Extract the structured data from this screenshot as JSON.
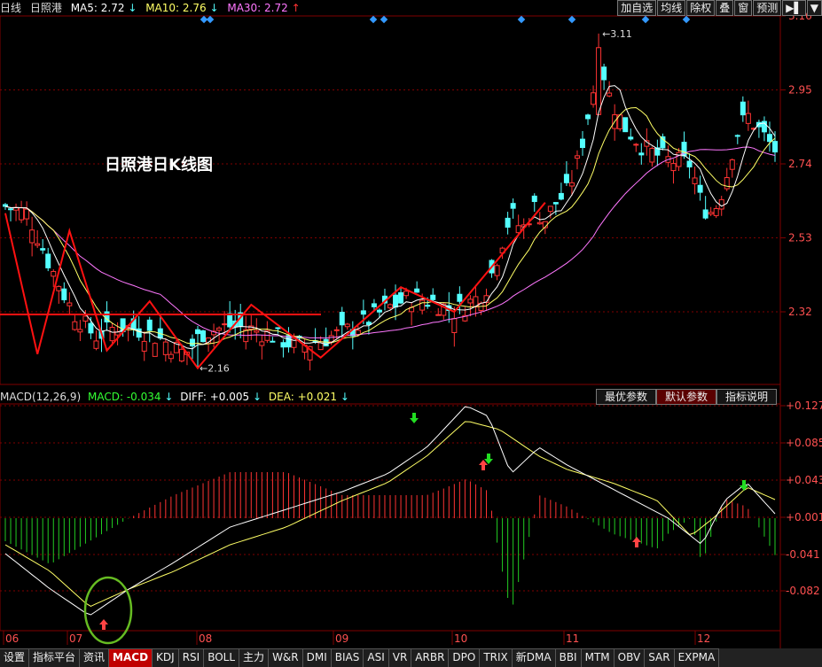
{
  "header": {
    "period": "日线",
    "stock_name": "日照港",
    "ma5_label": "MA5:",
    "ma5_value": "2.72",
    "ma5_arrow": "↓",
    "ma10_label": "MA10:",
    "ma10_value": "2.76",
    "ma10_arrow": "↓",
    "ma30_label": "MA30:",
    "ma30_value": "2.72",
    "ma30_arrow": "↑"
  },
  "toolbar": {
    "add_watch": "加自选",
    "ma_line": "均线",
    "ex_right": "除权",
    "overlay": "叠",
    "window": "窗",
    "forecast": "预测",
    "more": "▶▌",
    "menu": "▼"
  },
  "chart_title": "日照港日K线图",
  "price_axis": [
    "3.16",
    "2.95",
    "2.74",
    "2.53",
    "2.32"
  ],
  "annotations": {
    "high": "3.11",
    "low": "2.16"
  },
  "macd_header": {
    "name": "MACD(12,26,9)",
    "macd_label": "MACD:",
    "macd_value": "-0.034",
    "macd_arrow": "↓",
    "diff_label": "DIFF:",
    "diff_value": "+0.005",
    "diff_arrow": "↓",
    "dea_label": "DEA:",
    "dea_value": "+0.021",
    "dea_arrow": "↓"
  },
  "macd_buttons": {
    "optimal": "最优参数",
    "default": "默认参数",
    "help": "指标说明"
  },
  "macd_axis": [
    "+0.127",
    "+0.085",
    "+0.043",
    "+0.001",
    "-0.041",
    "-0.082"
  ],
  "months": [
    "06",
    "07",
    "08",
    "09",
    "10",
    "11",
    "12"
  ],
  "tabs": [
    "设置",
    "指标平台",
    "资讯",
    "MACD",
    "KDJ",
    "RSI",
    "BOLL",
    "主力",
    "W&R",
    "DMI",
    "BIAS",
    "ASI",
    "VR",
    "ARBR",
    "DPO",
    "TRIX",
    "新DMA",
    "BBI",
    "MTM",
    "OBV",
    "SAR",
    "EXPMA"
  ],
  "active_tab": "MACD",
  "colors": {
    "up": "#ff3333",
    "down": "#54ffff",
    "ma5": "#ffffff",
    "ma10": "#ffff66",
    "ma30": "#ff77ff",
    "grid": "#800000",
    "axis_text": "#ff5050"
  },
  "chart_data": {
    "type": "candlestick",
    "price_range": [
      2.16,
      3.16
    ],
    "ma_lines": [
      "MA5",
      "MA10",
      "MA30"
    ],
    "indicator": "MACD",
    "indicator_range": [
      -0.1,
      0.127
    ]
  }
}
